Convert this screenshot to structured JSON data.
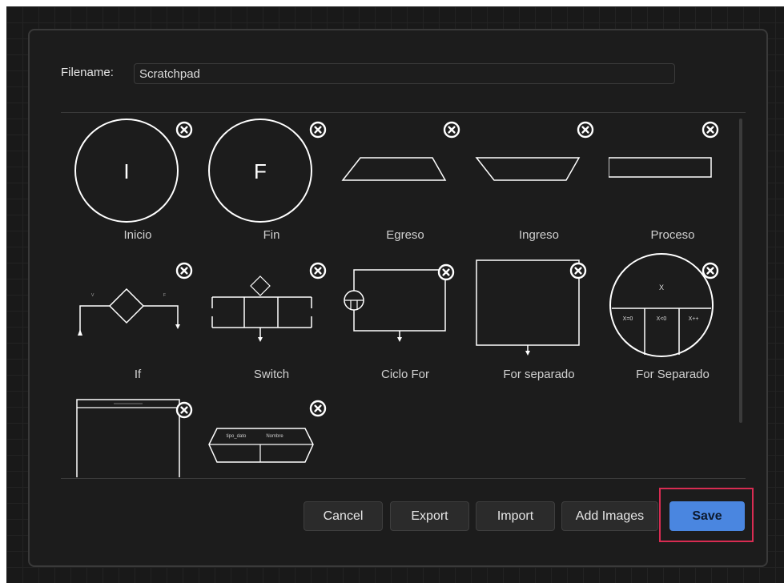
{
  "filename": {
    "label": "Filename:",
    "value": "Scratchpad"
  },
  "items": [
    {
      "label": "Inicio",
      "glyph": "I"
    },
    {
      "label": "Fin",
      "glyph": "F"
    },
    {
      "label": "Egreso"
    },
    {
      "label": "Ingreso"
    },
    {
      "label": "Proceso"
    },
    {
      "label": "If",
      "mini": [
        "V",
        "F"
      ]
    },
    {
      "label": "Switch"
    },
    {
      "label": "Ciclo For"
    },
    {
      "label": "For separado"
    },
    {
      "label": "For Separado",
      "mini": [
        "X",
        "X=0",
        "X<0",
        "X++"
      ]
    },
    {
      "label": ""
    },
    {
      "label": "",
      "mini": [
        "tipo_dato",
        "Nombre"
      ]
    }
  ],
  "buttons": {
    "cancel": "Cancel",
    "export": "Export",
    "import": "Import",
    "add_images": "Add Images",
    "save": "Save"
  },
  "colors": {
    "accent": "#4a86e0",
    "highlight": "#d82c52",
    "background": "#191919",
    "stroke": "#ffffff"
  }
}
